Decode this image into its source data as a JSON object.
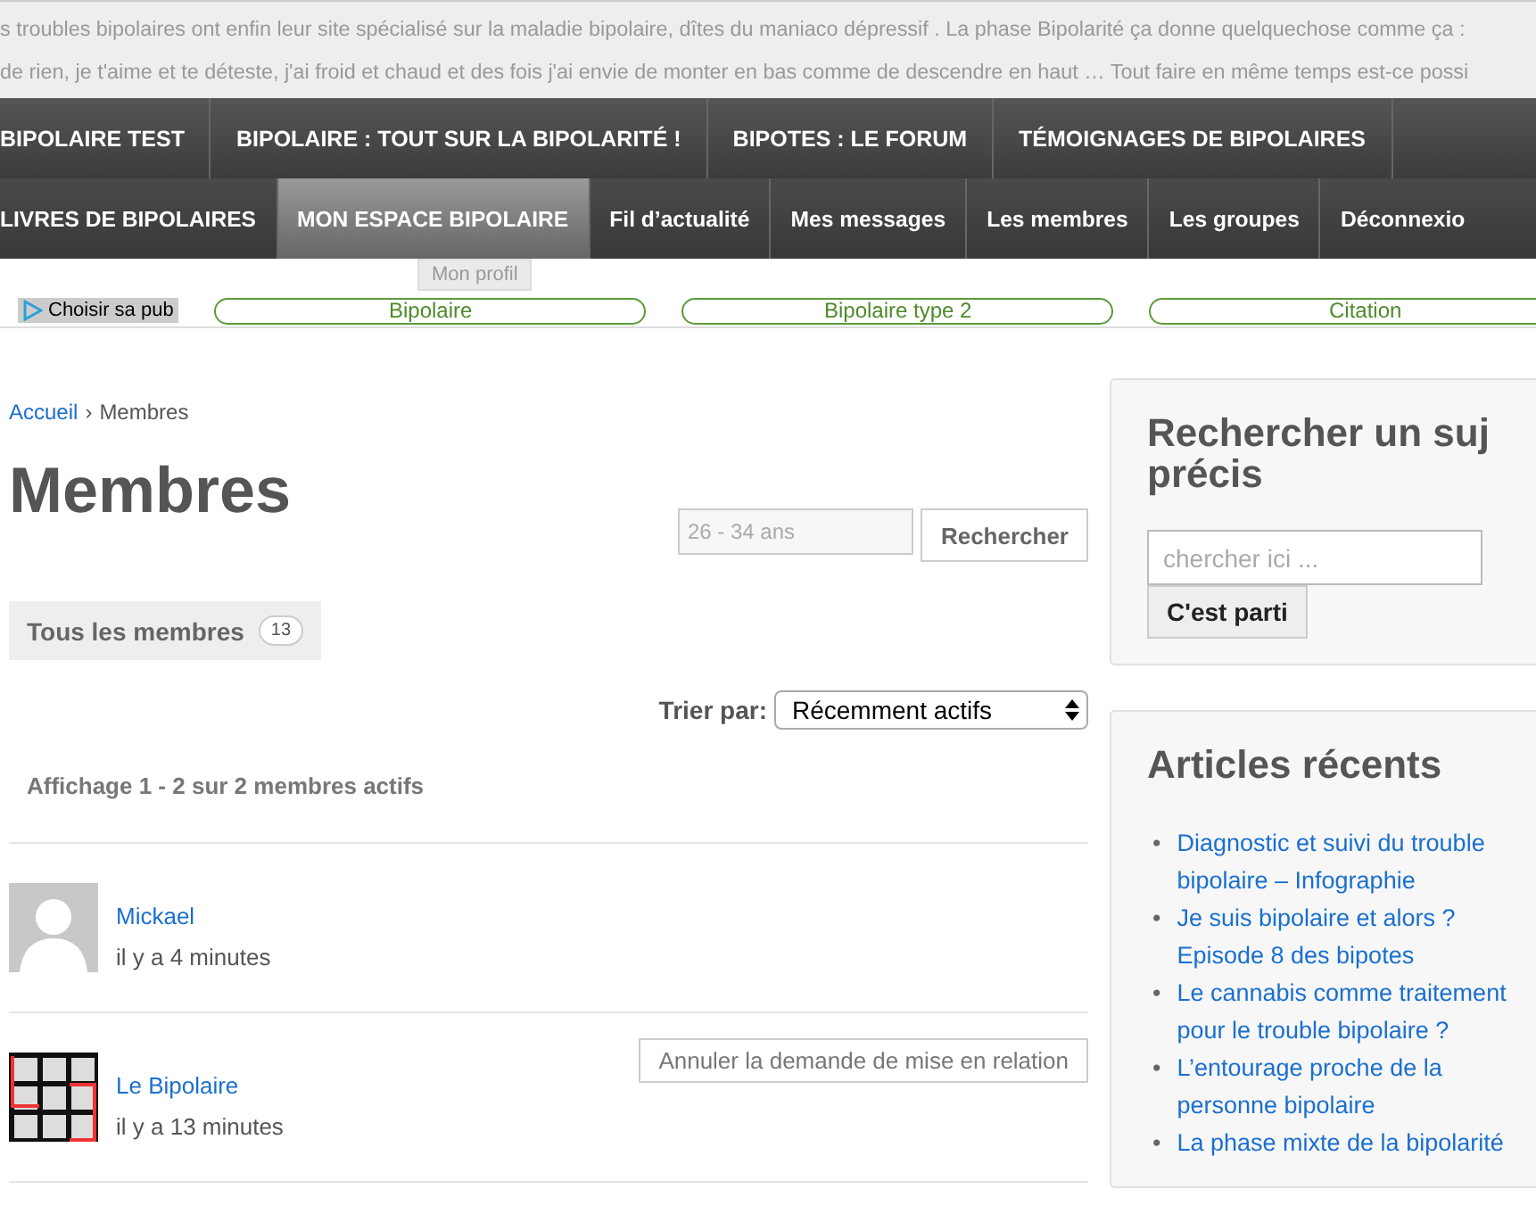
{
  "intro_lines": [
    "s troubles bipolaires ont enfin leur site spécialisé sur la maladie bipolaire, dîtes du maniaco dépressif . La phase Bipolarité ça donne quelquechose comme ça :",
    "de rien, je t'aime et te déteste, j'ai froid et chaud et des fois j'ai envie de monter en bas comme de descendre en haut … Tout faire en même temps est-ce possi"
  ],
  "nav_primary": [
    {
      "label": "BIPOLAIRE TEST",
      "selected": false
    },
    {
      "label": "BIPOLAIRE : TOUT SUR LA BIPOLARITÉ !",
      "selected": false
    },
    {
      "label": "BIPOTES : LE FORUM",
      "selected": false
    },
    {
      "label": "TÉMOIGNAGES DE BIPOLAIRES",
      "selected": false
    }
  ],
  "nav_secondary": [
    {
      "label": "LIVRES DE BIPOLAIRES",
      "selected": false
    },
    {
      "label": "MON ESPACE BIPOLAIRE",
      "selected": true
    },
    {
      "label": "Fil d’actualité",
      "selected": false
    },
    {
      "label": "Mes messages",
      "selected": false
    },
    {
      "label": "Les membres",
      "selected": false
    },
    {
      "label": "Les groupes",
      "selected": false
    },
    {
      "label": "Déconnexio",
      "selected": false
    }
  ],
  "tooltip": "Mon profil",
  "ad_bar": {
    "choose_label": "Choisir sa pub",
    "links": [
      "Bipolaire",
      "Bipolaire type 2",
      "Citation"
    ]
  },
  "breadcrumb": {
    "home": "Accueil",
    "separator": "›",
    "current": "Membres"
  },
  "page_title": "Membres",
  "member_search": {
    "value": "26 - 34 ans",
    "button": "Rechercher"
  },
  "member_tab": {
    "label": "Tous les membres",
    "count": "13",
    "selected": true
  },
  "sort": {
    "label": "Trier par:",
    "value": "Récemment actifs"
  },
  "pagination_info": "Affichage 1 - 2 sur 2 membres actifs",
  "members": [
    {
      "name": "Mickael",
      "last_active": "il y a 4 minutes",
      "kind": "default"
    },
    {
      "name": "Le Bipolaire",
      "last_active": "il y a 13 minutes",
      "kind": "logo",
      "action": "Annuler la demande de mise en relation"
    }
  ],
  "sidebar": {
    "search": {
      "title": "Rechercher un suj précis",
      "placeholder": "chercher ici ...",
      "button": "C'est parti"
    },
    "recent": {
      "title": "Articles récents",
      "bullet": "•",
      "items": [
        "Diagnostic et suivi du trouble bipolaire – Infographie",
        "Je suis bipolaire et alors ? Episode 8 des bipotes",
        "Le cannabis comme traitement pour le trouble bipolaire ?",
        "L’entourage proche de la personne bipolaire",
        "La phase mixte de la bipolarité"
      ]
    }
  }
}
